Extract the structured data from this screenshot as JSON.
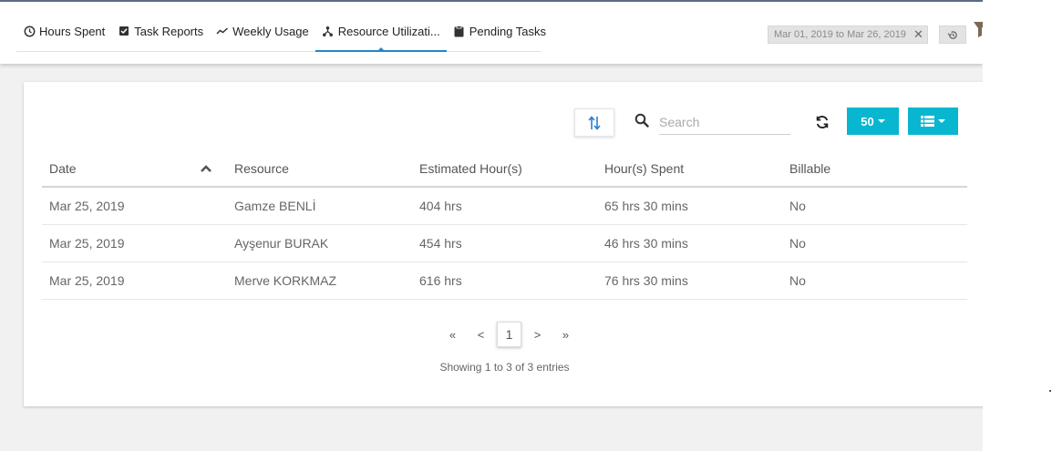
{
  "tabs": [
    {
      "label": "Hours Spent",
      "icon": "clock-icon"
    },
    {
      "label": "Task Reports",
      "icon": "checkbox-icon"
    },
    {
      "label": "Weekly Usage",
      "icon": "trend-line-icon"
    },
    {
      "label": "Resource Utilizati...",
      "icon": "network-icon",
      "active": true
    },
    {
      "label": "Pending Tasks",
      "icon": "clipboard-icon"
    }
  ],
  "date_filter": {
    "label": "Mar 01, 2019 to Mar 26, 2019",
    "clear_icon": "close-icon"
  },
  "toolbar": {
    "search_placeholder": "Search",
    "page_size_label": "50",
    "colors": {
      "accent": "#08b6cf",
      "tab_underline": "#1e88c9"
    }
  },
  "table": {
    "columns": [
      "Date",
      "Resource",
      "Estimated Hour(s)",
      "Hour(s) Spent",
      "Billable"
    ],
    "sorted_column": "Date",
    "sort_direction": "asc",
    "rows": [
      [
        "Mar 25, 2019",
        "Gamze BENLİ",
        "404 hrs",
        "65 hrs 30 mins",
        "No"
      ],
      [
        "Mar 25, 2019",
        "Ayşenur BURAK",
        "454 hrs",
        "46 hrs 30 mins",
        "No"
      ],
      [
        "Mar 25, 2019",
        "Merve KORKMAZ",
        "616 hrs",
        "76 hrs 30 mins",
        "No"
      ]
    ]
  },
  "pagination": {
    "first": "«",
    "prev": "<",
    "current": "1",
    "next": ">",
    "last": "»",
    "info": "Showing 1 to 3 of 3 entries"
  }
}
